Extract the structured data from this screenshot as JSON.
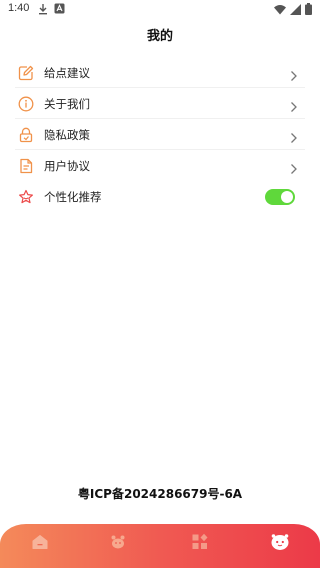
{
  "status_bar": {
    "time": "1:40",
    "left_icons": [
      "download-icon",
      "notification-a-icon"
    ],
    "right_icons": [
      "wifi-icon",
      "signal-icon",
      "battery-icon"
    ]
  },
  "header": {
    "title": "我的"
  },
  "menu": {
    "items": [
      {
        "label": "给点建议",
        "icon": "edit-icon"
      },
      {
        "label": "关于我们",
        "icon": "info-icon"
      },
      {
        "label": "隐私政策",
        "icon": "lock-icon"
      },
      {
        "label": "用户协议",
        "icon": "document-icon"
      },
      {
        "label": "个性化推荐",
        "icon": "star-icon",
        "toggle_on": true
      }
    ]
  },
  "footer": {
    "icp": "粤ICP备2024286679号-6A"
  },
  "bottom_nav": {
    "items": [
      "home-icon",
      "pet-icon",
      "apps-icon",
      "profile-icon"
    ],
    "active_index": 3
  },
  "colors": {
    "accent_orange": "#f0924a",
    "toggle_green": "#5fd83b",
    "nav_gradient_start": "#f48a5a",
    "nav_gradient_end": "#ec3a48"
  }
}
